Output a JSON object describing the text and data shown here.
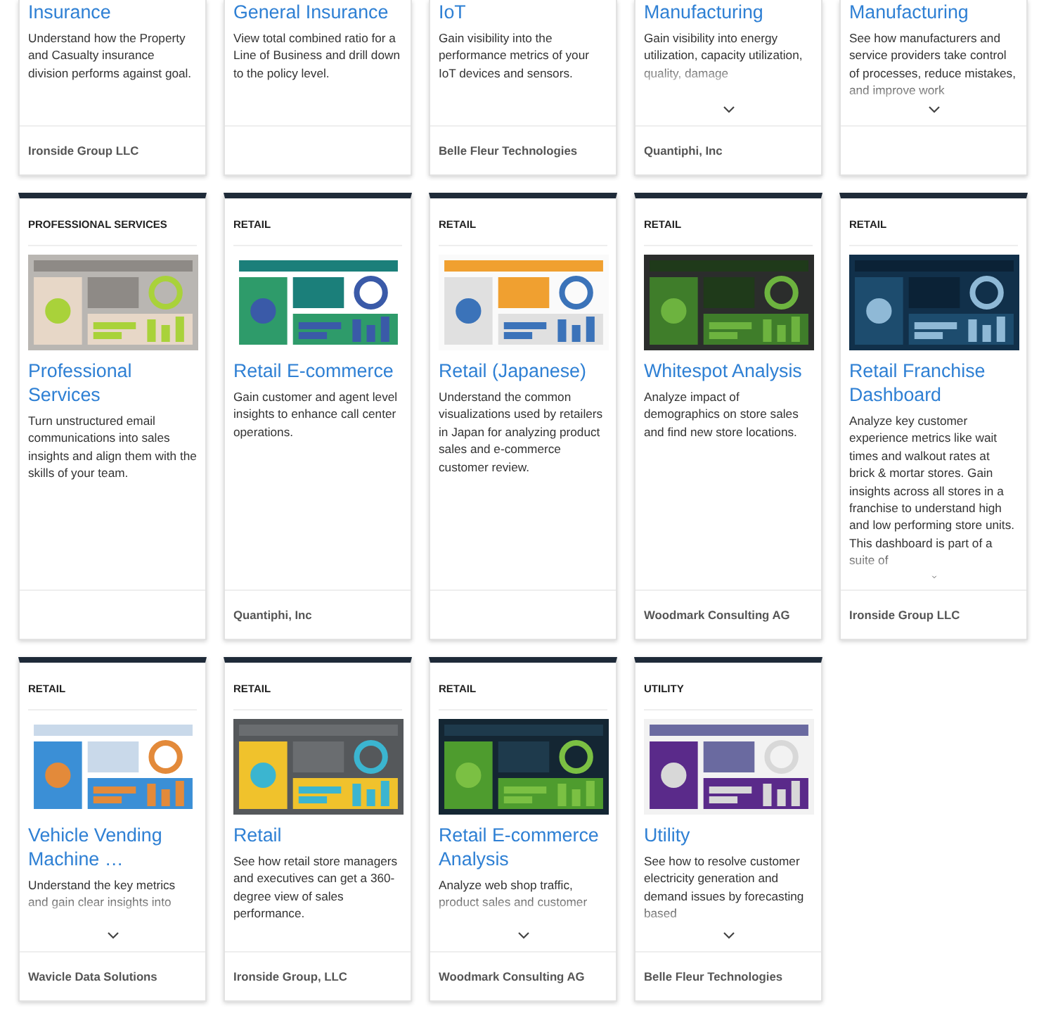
{
  "cards": [
    {
      "title": "Insurance",
      "description": "Understand how the Property and Casualty insurance division performs against goal.",
      "truncated": false,
      "vendor": "Ironside Group LLC"
    },
    {
      "title": "General Insurance",
      "description": "View total combined ratio for a Line of Business and drill down to the policy level.",
      "truncated": false
    },
    {
      "title": "IoT",
      "description": "Gain visibility into the performance metrics of your IoT devices and sensors.",
      "truncated": false,
      "vendor": "Belle Fleur Technologies"
    },
    {
      "title": "Manufacturing",
      "description": "Gain visibility into energy utilization, capacity utilization, quality, damage",
      "truncated": true,
      "vendor": "Quantiphi, Inc"
    },
    {
      "title": "Manufacturing",
      "description": "See how manufacturers and service providers take control of processes, reduce mistakes, and improve work",
      "truncated": true
    },
    {
      "category": "PROFESSIONAL SERVICES",
      "title": "Professional Services",
      "description": "Turn unstructured email communications into sales insights and align them with the skills of your team.",
      "truncated": false
    },
    {
      "category": "RETAIL",
      "title": "Retail E-commerce",
      "description": "Gain customer and agent level insights to enhance call center operations.",
      "truncated": false,
      "vendor": "Quantiphi, Inc"
    },
    {
      "category": "RETAIL",
      "title": "Retail (Japanese)",
      "description": "Understand the common visualizations used by retailers in Japan for analyzing product sales and e-commerce customer review.",
      "truncated": false
    },
    {
      "category": "RETAIL",
      "title": "Whitespot Analysis",
      "description": "Analyze impact of demographics on store sales and find new store locations.",
      "truncated": false,
      "vendor": "Woodmark Consulting AG"
    },
    {
      "category": "RETAIL",
      "title": "Retail Franchise Dashboard",
      "description": "Analyze key customer experience metrics like wait times and walkout rates at brick & mortar stores. Gain insights across all stores in a franchise to understand high and low performing store units. This dashboard is part of a suite of",
      "truncated": true,
      "vendor": "Ironside Group LLC"
    },
    {
      "category": "RETAIL",
      "title": "Vehicle Vending Machine …",
      "description": "Understand the key metrics and gain clear insights into",
      "truncated": true,
      "vendor": "Wavicle Data Solutions"
    },
    {
      "category": "RETAIL",
      "title": "Retail",
      "description": "See how retail store managers and executives can get a 360-degree view of sales performance.",
      "truncated": false,
      "vendor": "Ironside Group, LLC"
    },
    {
      "category": "RETAIL",
      "title": "Retail E-commerce Analysis",
      "description": "Analyze web shop traffic, product sales and customer",
      "truncated": true,
      "vendor": "Woodmark Consulting AG"
    },
    {
      "category": "UTILITY",
      "title": "Utility",
      "description": "See how to resolve customer electricity generation and demand issues by forecasting based",
      "truncated": true,
      "vendor": "Belle Fleur Technologies"
    }
  ]
}
